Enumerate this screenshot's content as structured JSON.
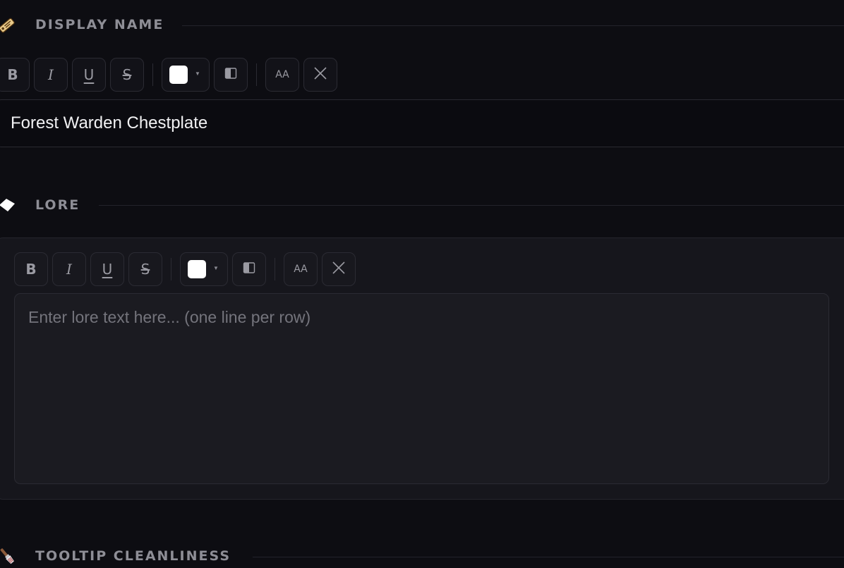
{
  "sections": {
    "display_name": {
      "title": "DISPLAY NAME",
      "icon": "name-tag-icon",
      "value": "Forest Warden Chestplate"
    },
    "lore": {
      "title": "LORE",
      "icon": "paper-icon",
      "placeholder": "Enter lore text here... (one line per row)"
    },
    "tooltip_cleanliness": {
      "title": "TOOLTIP CLEANLINESS",
      "icon": "brush-icon"
    }
  },
  "toolbar": {
    "bold": "B",
    "italic": "I",
    "underline": "U",
    "strike": "S",
    "size": "AA",
    "color_value": "#ffffff"
  },
  "colors": {
    "background": "#0d0d12",
    "card": "#16161c",
    "header_text": "#8e8e96",
    "accent_tag": "#d9a441"
  }
}
